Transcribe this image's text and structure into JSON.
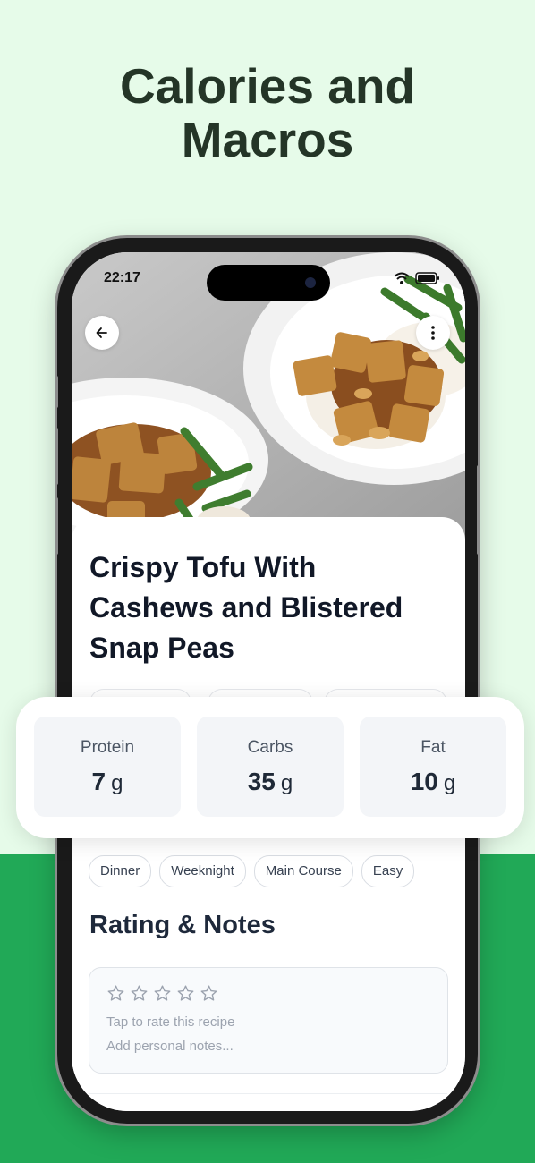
{
  "headline": {
    "line1": "Calories and",
    "line2": "Macros"
  },
  "status_bar": {
    "time": "22:17"
  },
  "recipe": {
    "title": "Crispy Tofu With Cashews and Blistered Snap Peas"
  },
  "macros": [
    {
      "label": "Protein",
      "value": "7",
      "unit": "g"
    },
    {
      "label": "Carbs",
      "value": "35",
      "unit": "g"
    },
    {
      "label": "Fat",
      "value": "10",
      "unit": "g"
    }
  ],
  "tags": [
    "Dinner",
    "Weeknight",
    "Main Course",
    "Easy"
  ],
  "rating": {
    "section_title": "Rating & Notes",
    "stars_total": 5,
    "stars_filled": 0,
    "rate_hint": "Tap to rate this recipe",
    "notes_placeholder": "Add personal notes..."
  },
  "icons": {
    "back": "arrow-left-icon",
    "more": "more-vertical-icon",
    "wifi": "wifi-icon",
    "battery": "battery-icon",
    "star": "star-outline-icon"
  },
  "colors": {
    "top_background": "#e6fbe9",
    "bottom_background": "#21a957",
    "headline": "#243527"
  }
}
